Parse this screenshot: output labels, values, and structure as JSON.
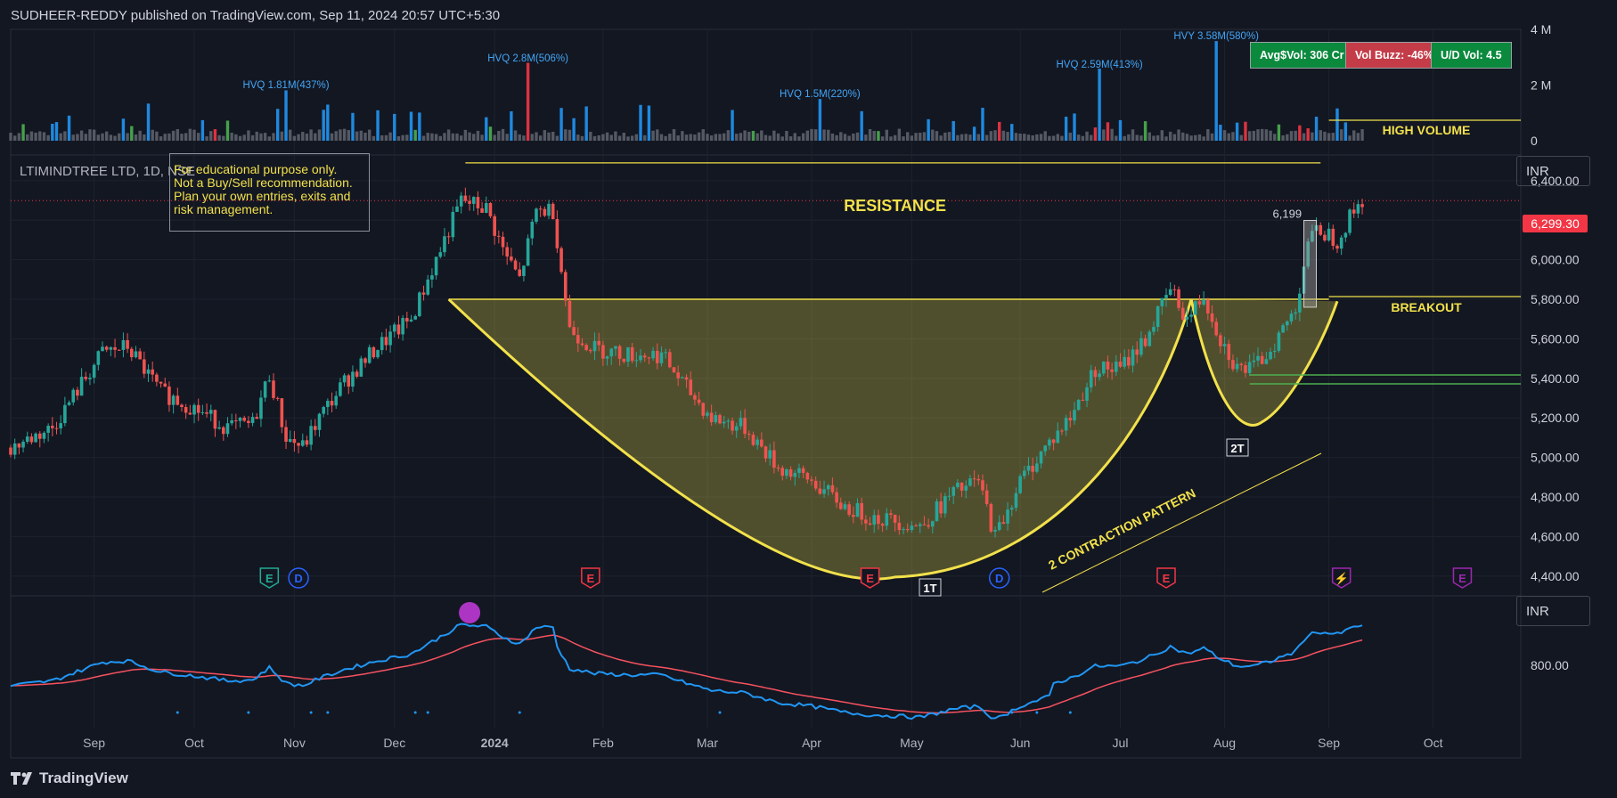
{
  "header": {
    "published_by": "SUDHEER-REDDY published on TradingView.com, Sep 11, 2024 20:57 UTC+5:30"
  },
  "symbol": {
    "label": "LTIMINDTREE LTD, 1D, NSE"
  },
  "disclaimer": {
    "lines": [
      "For educational purpose only.",
      "Not a Buy/Sell recommendation.",
      "Plan your own entries, exits and",
      "risk management."
    ]
  },
  "badges": {
    "avg_vol": "Avg$Vol: 306 Cr",
    "vol_buzz": "Vol Buzz: -46%",
    "ud_vol": "U/D Vol: 4.5"
  },
  "currency": "INR",
  "last_price": "6,299.30",
  "annotations": {
    "resistance": "RESISTANCE",
    "breakout": "BREAKOUT",
    "high_volume": "HIGH VOLUME",
    "contraction": "2 CONTRACTION PATTERN",
    "t1": "1T",
    "t2": "2T",
    "level_6199": "6,199"
  },
  "hvq_labels": [
    {
      "text": "HVQ 1.81M(437%)",
      "day": 66
    },
    {
      "text": "HVQ 2.8M(506%)",
      "day": 124
    },
    {
      "text": "HVQ 1.5M(220%)",
      "day": 194
    },
    {
      "text": "HVQ 2.59M(413%)",
      "day": 261
    },
    {
      "text": "HVY 3.58M(580%)",
      "day": 289
    }
  ],
  "event_markers": [
    {
      "letter": "E",
      "color": "#22ab94",
      "day": 62
    },
    {
      "letter": "D",
      "color": "#2962ff",
      "day": 69
    },
    {
      "letter": "E",
      "color": "#f23645",
      "day": 139
    },
    {
      "letter": "E",
      "color": "#f23645",
      "day": 206
    },
    {
      "letter": "D",
      "color": "#2962ff",
      "day": 237
    },
    {
      "letter": "E",
      "color": "#f23645",
      "day": 277
    },
    {
      "letter": "⚡",
      "color": "#9c27b0",
      "day": 319
    },
    {
      "letter": "E",
      "color": "#9c27b0",
      "day": 348
    }
  ],
  "footer": {
    "brand": "TradingView"
  },
  "chart_data": {
    "type": "candlestick",
    "title": "LTIMINDTREE LTD, 1D, NSE",
    "currency": "INR",
    "last_price": 6299.3,
    "x_ticks": [
      "Sep",
      "Oct",
      "Nov",
      "Dec",
      "2024",
      "Feb",
      "Mar",
      "Apr",
      "May",
      "Jun",
      "Jul",
      "Aug",
      "Sep",
      "Oct"
    ],
    "x_tick_days": [
      20,
      44,
      68,
      92,
      116,
      142,
      167,
      192,
      216,
      242,
      266,
      291,
      316,
      341
    ],
    "y_ticks": [
      4400,
      4600,
      4800,
      5000,
      5200,
      5400,
      5600,
      5800,
      6000,
      6200,
      6400
    ],
    "y_tick_labels": [
      "4,400.00",
      "4,600.00",
      "4,800.00",
      "5,000.00",
      "5,200.00",
      "5,400.00",
      "5,600.00",
      "5,800.00",
      "6,000.00",
      "6,200.00",
      "6,400.00"
    ],
    "ylim": [
      4300,
      6530
    ],
    "x_range_days": [
      0,
      362
    ],
    "price_path": [
      [
        0,
        5050
      ],
      [
        10,
        5150
      ],
      [
        22,
        5530
      ],
      [
        28,
        5560
      ],
      [
        36,
        5330
      ],
      [
        44,
        5250
      ],
      [
        52,
        5150
      ],
      [
        58,
        5170
      ],
      [
        62,
        5420
      ],
      [
        66,
        5100
      ],
      [
        70,
        5050
      ],
      [
        74,
        5200
      ],
      [
        80,
        5380
      ],
      [
        88,
        5560
      ],
      [
        96,
        5700
      ],
      [
        102,
        6000
      ],
      [
        108,
        6300
      ],
      [
        114,
        6260
      ],
      [
        118,
        6050
      ],
      [
        122,
        5900
      ],
      [
        126,
        6250
      ],
      [
        130,
        6250
      ],
      [
        134,
        5650
      ],
      [
        140,
        5550
      ],
      [
        148,
        5520
      ],
      [
        156,
        5520
      ],
      [
        162,
        5350
      ],
      [
        168,
        5200
      ],
      [
        176,
        5150
      ],
      [
        184,
        4950
      ],
      [
        192,
        4880
      ],
      [
        200,
        4750
      ],
      [
        206,
        4700
      ],
      [
        212,
        4680
      ],
      [
        218,
        4650
      ],
      [
        226,
        4820
      ],
      [
        232,
        4880
      ],
      [
        236,
        4600
      ],
      [
        242,
        4880
      ],
      [
        248,
        5050
      ],
      [
        254,
        5200
      ],
      [
        260,
        5450
      ],
      [
        266,
        5450
      ],
      [
        272,
        5600
      ],
      [
        278,
        5850
      ],
      [
        282,
        5700
      ],
      [
        286,
        5820
      ],
      [
        290,
        5600
      ],
      [
        294,
        5450
      ],
      [
        298,
        5450
      ],
      [
        302,
        5550
      ],
      [
        308,
        5750
      ],
      [
        311,
        6100
      ],
      [
        314,
        6150
      ],
      [
        318,
        6100
      ],
      [
        322,
        6250
      ],
      [
        324,
        6300
      ]
    ],
    "volume": {
      "ylim": [
        0,
        4000000
      ],
      "y_ticks": [
        0,
        2000000,
        4000000
      ],
      "y_tick_labels": [
        "0",
        "2 M",
        "4 M"
      ],
      "spikes": [
        {
          "day": 66,
          "value": 1810000
        },
        {
          "day": 124,
          "value": 2800000
        },
        {
          "day": 194,
          "value": 1500000
        },
        {
          "day": 261,
          "value": 2590000
        },
        {
          "day": 289,
          "value": 3580000
        }
      ]
    },
    "levels": {
      "resistance": 6490,
      "breakout": 5800,
      "neckline_a": 5490,
      "neckline_b": 5440,
      "level_6199": 6199
    },
    "indicator": {
      "currency": "INR",
      "y_ticks": [
        800
      ],
      "y_tick_labels": [
        "800.00"
      ]
    }
  }
}
